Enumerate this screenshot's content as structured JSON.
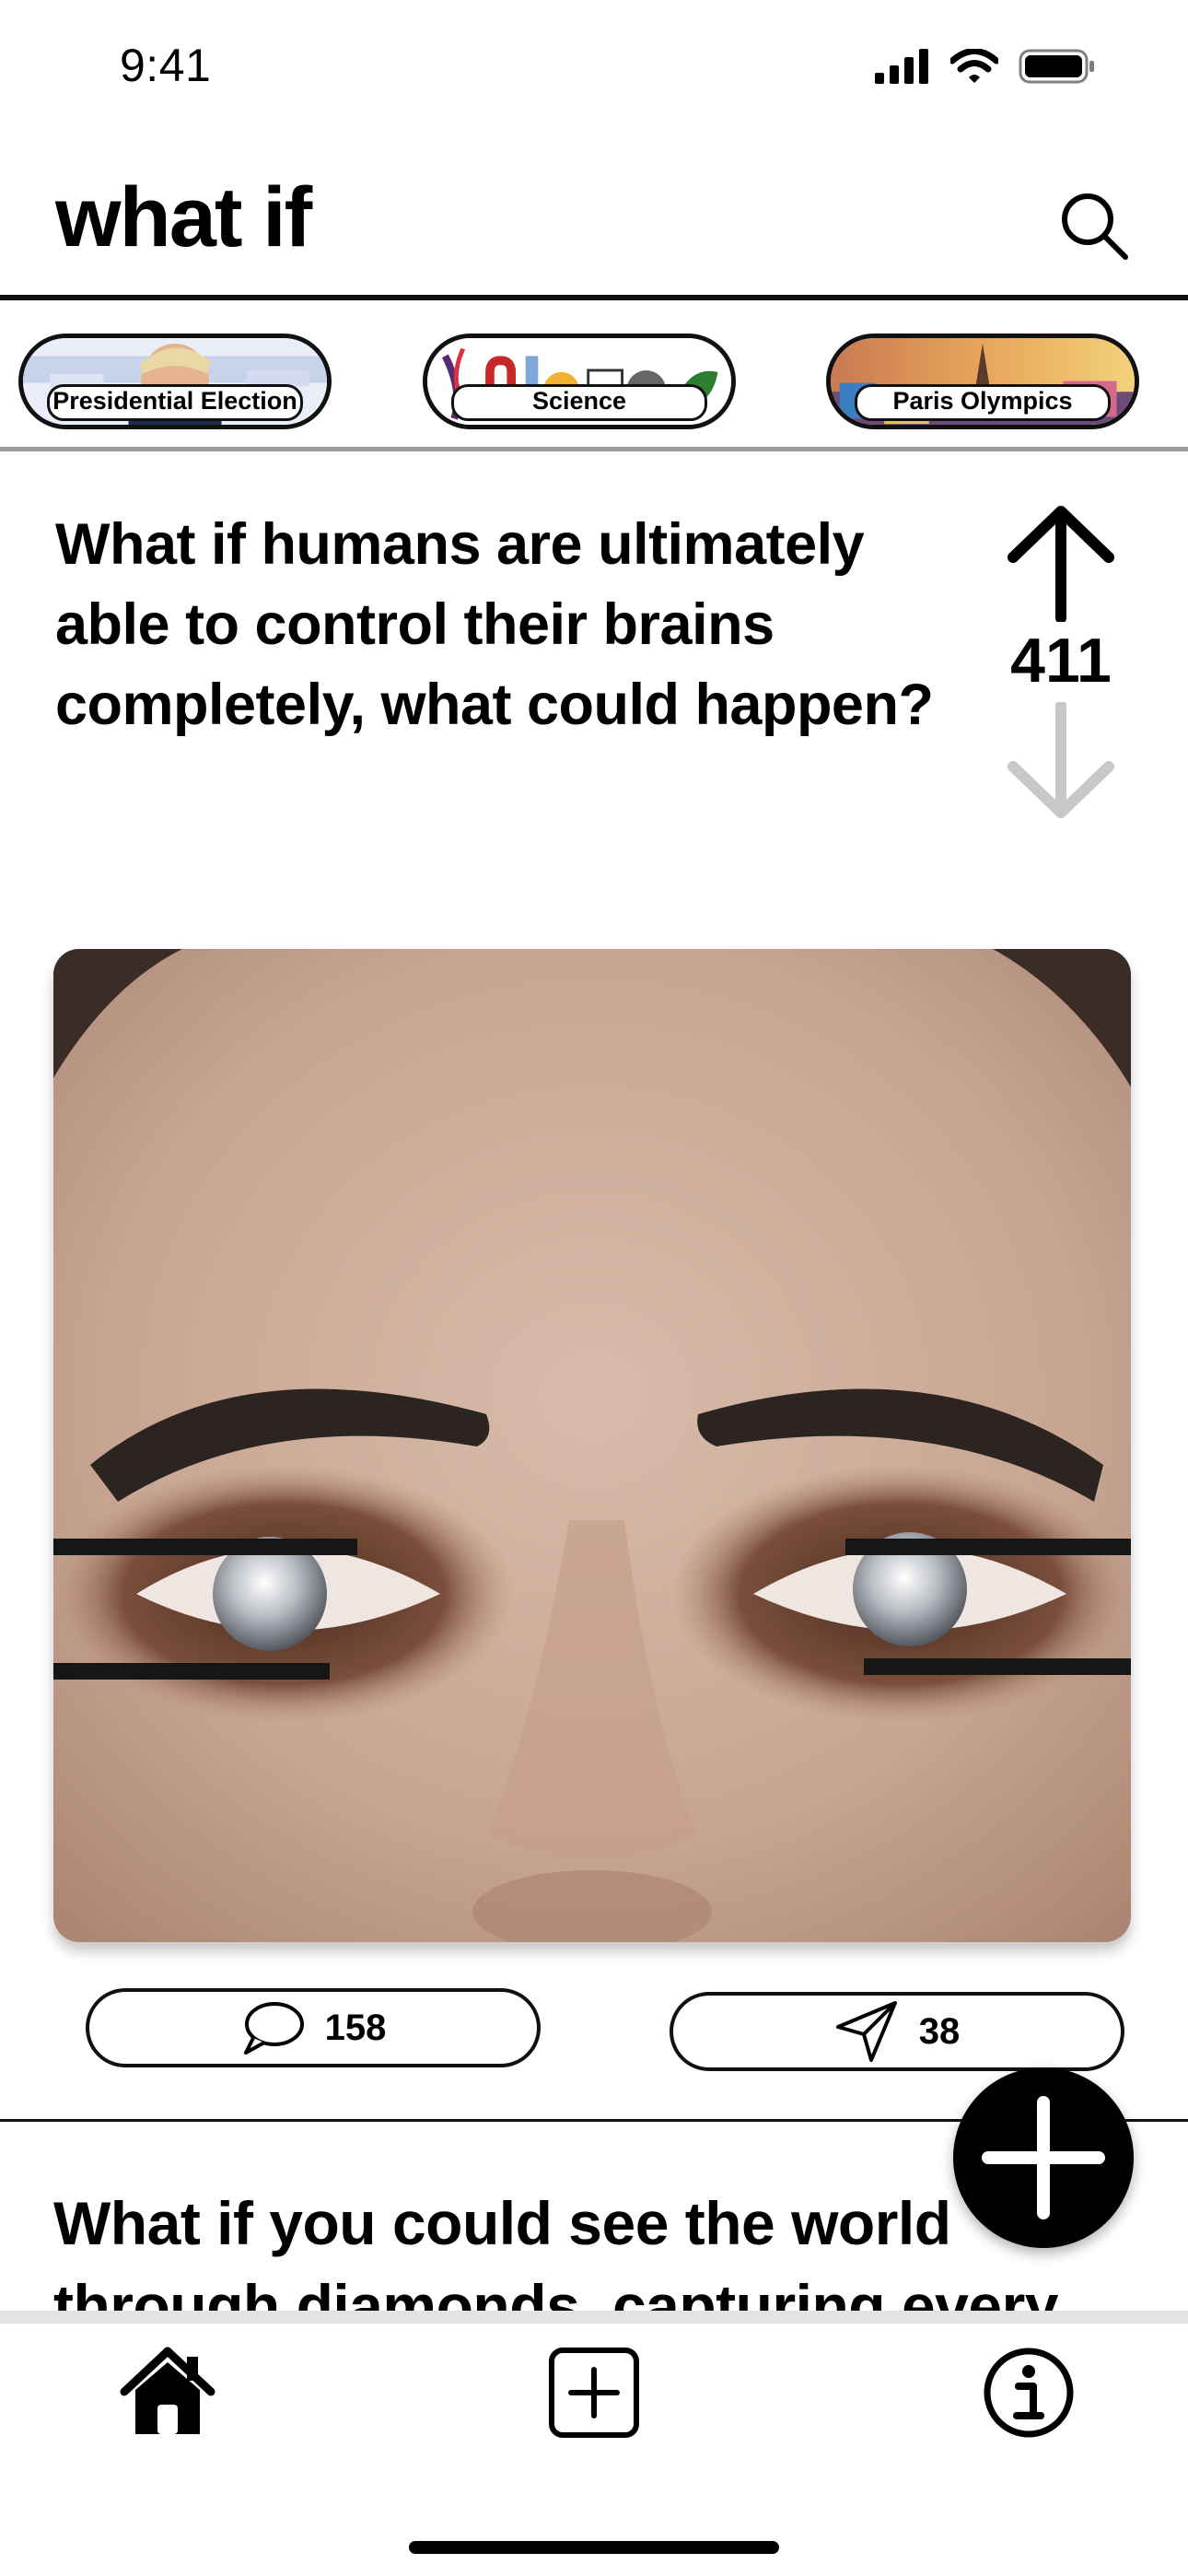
{
  "status_bar": {
    "time": "9:41",
    "icons": [
      "signal-icon",
      "wifi-icon",
      "battery-icon"
    ]
  },
  "header": {
    "title": "what if",
    "search_icon": "search-icon"
  },
  "topics": [
    {
      "label": "Presidential Election"
    },
    {
      "label": "Science"
    },
    {
      "label": "Paris Olympics"
    }
  ],
  "posts": [
    {
      "question": "What if humans are ultimately able to control their brains completely, what could happen?",
      "votes": "411",
      "comments": "158",
      "shares": "38"
    },
    {
      "question": "What if you could see the world through diamonds, capturing every"
    }
  ],
  "tabs": [
    {
      "icon": "home-icon"
    },
    {
      "icon": "add-square-icon"
    },
    {
      "icon": "info-icon"
    }
  ],
  "fab": {
    "icon": "plus-icon"
  },
  "colors": {
    "text": "#000000",
    "vote_down": "#c8c8c8",
    "divider": "#999999",
    "tabbar_border": "#e3e3e3"
  }
}
